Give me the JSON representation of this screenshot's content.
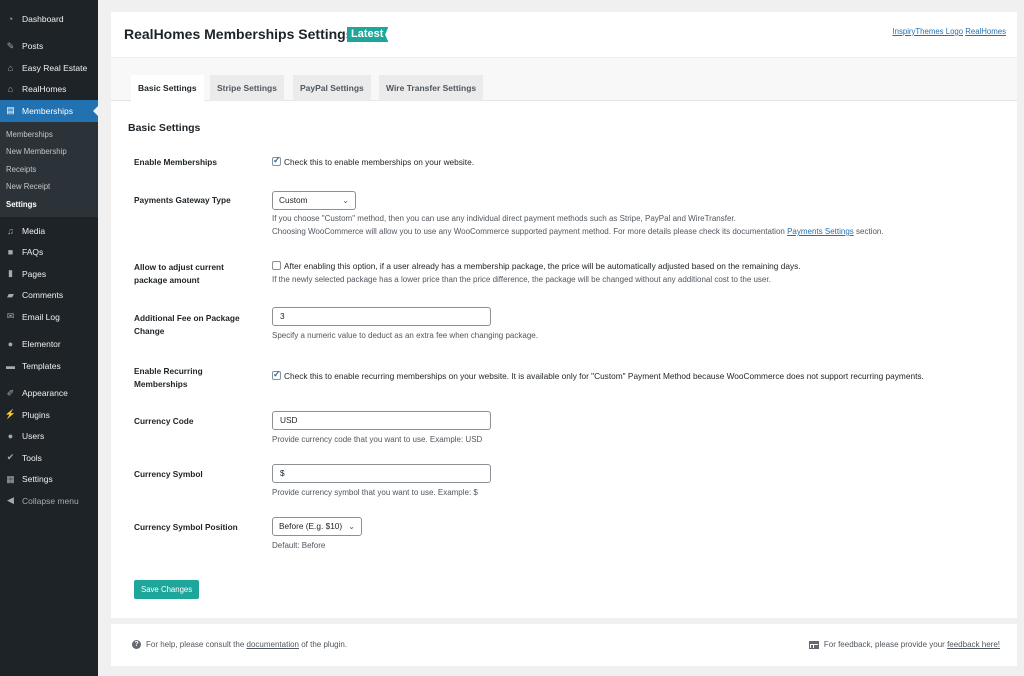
{
  "sidebar": {
    "items": [
      {
        "label": "Dashboard",
        "icon": "dashboard-icon"
      },
      {
        "label": "Posts",
        "icon": "pin-icon"
      },
      {
        "label": "Easy Real Estate",
        "icon": "house-check-icon"
      },
      {
        "label": "RealHomes",
        "icon": "house-outline-icon"
      },
      {
        "label": "Memberships",
        "icon": "id-card-icon",
        "active": true
      },
      {
        "label": "Media",
        "icon": "media-icon"
      },
      {
        "label": "FAQs",
        "icon": "chat-bubbles-icon"
      },
      {
        "label": "Pages",
        "icon": "pages-icon"
      },
      {
        "label": "Comments",
        "icon": "comment-icon"
      },
      {
        "label": "Email Log",
        "icon": "envelope-icon"
      },
      {
        "label": "Elementor",
        "icon": "elementor-icon"
      },
      {
        "label": "Templates",
        "icon": "folder-icon"
      },
      {
        "label": "Appearance",
        "icon": "paintbrush-icon"
      },
      {
        "label": "Plugins",
        "icon": "plug-icon"
      },
      {
        "label": "Users",
        "icon": "user-icon"
      },
      {
        "label": "Tools",
        "icon": "wrench-icon"
      },
      {
        "label": "Settings",
        "icon": "sliders-icon"
      }
    ],
    "submenu": [
      "Memberships",
      "New Membership",
      "Receipts",
      "New Receipt",
      "Settings"
    ],
    "submenu_current": "Settings",
    "collapse_label": "Collapse menu"
  },
  "header": {
    "title": "RealHomes Memberships Settings",
    "badge": "Latest",
    "logo_link": "InspiryThemes Logo",
    "product_link": "RealHomes"
  },
  "tabs": [
    "Basic Settings",
    "Stripe Settings",
    "PayPal Settings",
    "Wire Transfer Settings"
  ],
  "active_tab": "Basic Settings",
  "section_title": "Basic Settings",
  "fields": {
    "enable_memberships": {
      "label": "Enable Memberships",
      "checked": true,
      "text": "Check this to enable memberships on your website."
    },
    "gateway": {
      "label": "Payments Gateway Type",
      "value": "Custom",
      "desc1": "If you choose \"Custom\" method, then you can use any individual direct payment methods such as Stripe, PayPal and WireTransfer.",
      "desc2_pre": "Choosing WooCommerce will allow you to use any WooCommerce supported payment method. For more details please check its documentation ",
      "desc2_link": "Payments Settings",
      "desc2_post": " section."
    },
    "adjust_amount": {
      "label": "Allow to adjust current package amount",
      "checked": false,
      "text": "After enabling this option, if a user already has a membership package, the price will be automatically adjusted based on the remaining days.",
      "desc": "If the newly selected package has a lower price than the price difference, the package will be changed without any additional cost to the user."
    },
    "additional_fee": {
      "label": "Additional Fee on Package Change",
      "value": "3",
      "desc": "Specify a numeric value to deduct as an extra fee when changing package."
    },
    "recurring": {
      "label": "Enable Recurring Memberships",
      "checked": true,
      "text": "Check this to enable recurring memberships on your website. It is available only for \"Custom\" Payment Method because WooCommerce does not support recurring payments."
    },
    "currency_code": {
      "label": "Currency Code",
      "value": "USD",
      "desc": "Provide currency code that you want to use. Example: USD"
    },
    "currency_symbol": {
      "label": "Currency Symbol",
      "value": "$",
      "desc": "Provide currency symbol that you want to use. Example: $"
    },
    "symbol_position": {
      "label": "Currency Symbol Position",
      "value": "Before (E.g. $10)",
      "desc": "Default: Before"
    }
  },
  "save_label": "Save Changes",
  "footer": {
    "help_pre": "For help, please consult the ",
    "help_link": "documentation",
    "help_post": " of the plugin.",
    "feedback_pre": "For feedback, please provide your ",
    "feedback_link": "feedback here!"
  },
  "colors": {
    "accent": "#1ea69a",
    "wp_blue": "#2271b1",
    "sidebar_bg": "#1d2327"
  }
}
